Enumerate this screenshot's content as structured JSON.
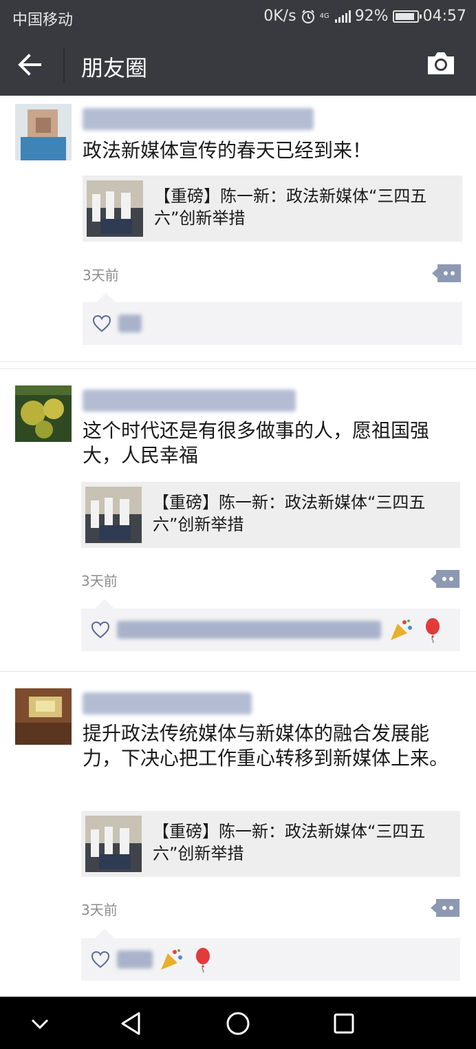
{
  "status": {
    "carrier": "中国移动",
    "speed": "0K/s",
    "network": "4G",
    "battery": "92%",
    "battery_level": 0.92,
    "time": "04:57"
  },
  "nav": {
    "back_icon": "arrow-left-icon",
    "title": "朋友圈",
    "camera_icon": "camera-icon"
  },
  "posts": [
    {
      "text": "政法新媒体宣传的春天已经到来！",
      "link_title": "【重磅】陈一新：政法新媒体“三四五六”创新举措",
      "time": "3天前"
    },
    {
      "text": "这个时代还是有很多做事的人，愿祖国强大，人民幸福",
      "link_title": "【重磅】陈一新：政法新媒体“三四五六”创新举措",
      "time": "3天前"
    },
    {
      "text": "提升政法传统媒体与新媒体的融合发展能力，下决心把工作重心转移到新媒体上来。",
      "link_title": "【重磅】陈一新：政法新媒体“三四五六”创新举措",
      "time": "3天前"
    }
  ],
  "colors": {
    "bar": "#393a3f",
    "link_bg": "#eeeeee",
    "likes_bg": "#f3f3f5",
    "wechat_blue": "#576b95"
  }
}
